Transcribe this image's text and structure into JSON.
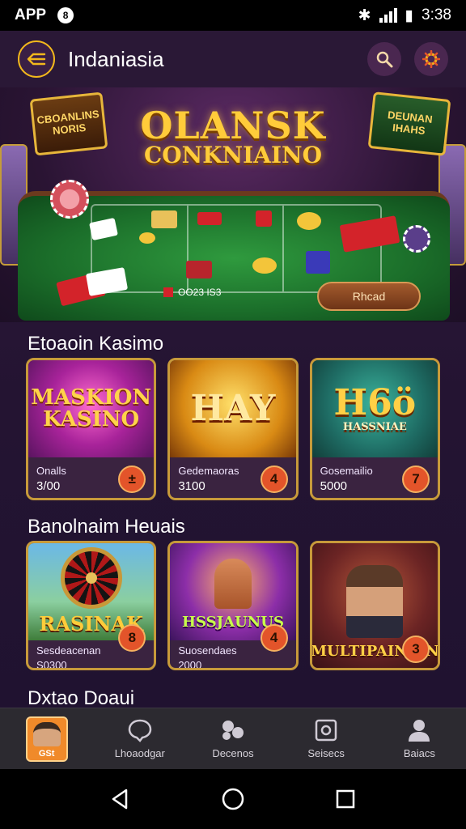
{
  "status_bar": {
    "app_label": "APP",
    "badge": "8",
    "time": "3:38"
  },
  "header": {
    "title": "Indaniasia"
  },
  "hero": {
    "title_line1": "OLANSK",
    "title_line2": "CONKNIAINO",
    "sign_left": "CBOANLINS NORIS",
    "sign_right": "DEUNAN IHAHS",
    "table_label": "OO23 IS3",
    "play_button": "Rhcad"
  },
  "section1": {
    "title": "Etoaoin Kasimo",
    "games": [
      {
        "art": "MASKION KASINO",
        "label": "Onalls",
        "price": "3/00",
        "badge": "±"
      },
      {
        "art": "HAY",
        "label": "Gedemaoras",
        "price": "3100",
        "badge": "4"
      },
      {
        "art": "H6ö",
        "art_sub": "HASSNIAE",
        "label": "Gosemailio",
        "price": "5000",
        "badge": "7"
      }
    ]
  },
  "section2": {
    "title": "Banolnaim Heuais",
    "games": [
      {
        "art": "RASINAK",
        "label": "Sesdeacenan",
        "price": "S0300",
        "badge": "8"
      },
      {
        "art": "HSSJAUNUS",
        "label": "Suosendaes",
        "price": "2000",
        "badge": "4"
      },
      {
        "art": "MULTIPAINAIN",
        "label": "",
        "price": "",
        "badge": "3"
      }
    ]
  },
  "section3": {
    "title": "Dxtao Doaui"
  },
  "bottom_nav": {
    "items": [
      {
        "label": "",
        "avatar_text": "GSt"
      },
      {
        "label": "Lhoaodgar"
      },
      {
        "label": "Decenos"
      },
      {
        "label": "Seisecs"
      },
      {
        "label": "Baiacs"
      }
    ]
  },
  "colors": {
    "accent": "#f2b81c",
    "background": "#2e1a3c",
    "badge": "#e3542a",
    "card_border": "#c79a3a"
  }
}
